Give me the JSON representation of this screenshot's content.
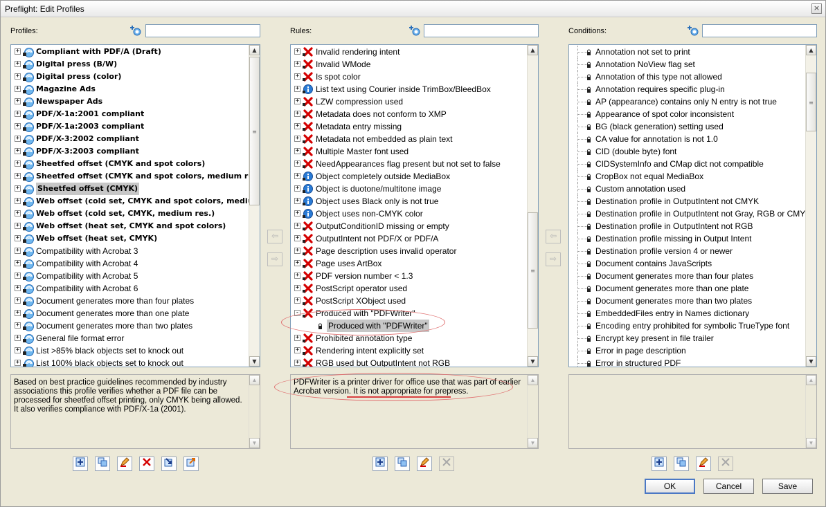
{
  "window": {
    "title": "Preflight: Edit Profiles",
    "close_glyph": "×"
  },
  "profiles": {
    "label": "Profiles:",
    "search_placeholder": "",
    "items": [
      {
        "label": "Compliant with PDF/A (Draft)",
        "bold": true
      },
      {
        "label": "Digital press (B/W)",
        "bold": true
      },
      {
        "label": "Digital press (color)",
        "bold": true
      },
      {
        "label": "Magazine Ads",
        "bold": true
      },
      {
        "label": "Newspaper Ads",
        "bold": true
      },
      {
        "label": "PDF/X-1a:2001 compliant",
        "bold": true
      },
      {
        "label": "PDF/X-1a:2003 compliant",
        "bold": true
      },
      {
        "label": "PDF/X-3:2002 compliant",
        "bold": true
      },
      {
        "label": "PDF/X-3:2003 compliant",
        "bold": true
      },
      {
        "label": "Sheetfed offset (CMYK and spot colors)",
        "bold": true
      },
      {
        "label": "Sheetfed offset (CMYK and spot colors, medium res.)",
        "bold": true
      },
      {
        "label": "Sheetfed offset (CMYK)",
        "bold": true,
        "selected": true
      },
      {
        "label": "Web offset (cold set, CMYK and spot colors, medium r",
        "bold": true
      },
      {
        "label": "Web offset (cold set, CMYK, medium res.)",
        "bold": true
      },
      {
        "label": "Web offset (heat set, CMYK and spot colors)",
        "bold": true
      },
      {
        "label": "Web offset (heat set, CMYK)",
        "bold": true
      },
      {
        "label": "Compatibility with Acrobat 3"
      },
      {
        "label": "Compatibility with Acrobat 4"
      },
      {
        "label": "Compatibility with Acrobat 5"
      },
      {
        "label": "Compatibility with Acrobat 6"
      },
      {
        "label": "Document generates more than four plates"
      },
      {
        "label": "Document generates more than one plate"
      },
      {
        "label": "Document generates more than two plates"
      },
      {
        "label": "General file format error"
      },
      {
        "label": "List >85% black objects set to knock out"
      },
      {
        "label": "List 100% black objects set to knock out"
      }
    ],
    "description": "Based on best practice guidelines recommended by industry associations this profile verifies whether a PDF file can be processed for sheetfed offset printing, only CMYK being allowed. It also verifies compliance with PDF/X-1a (2001).",
    "toolbar": [
      "new-icon",
      "duplicate-icon",
      "edit-icon",
      "delete-icon",
      "import-icon",
      "export-icon"
    ]
  },
  "rules": {
    "label": "Rules:",
    "search_placeholder": "",
    "items": [
      {
        "label": "Invalid rendering intent",
        "icon": "error"
      },
      {
        "label": "Invalid WMode",
        "icon": "error"
      },
      {
        "label": "Is spot color",
        "icon": "error"
      },
      {
        "label": "List text using Courier inside TrimBox/BleedBox",
        "icon": "info"
      },
      {
        "label": "LZW compression used",
        "icon": "error"
      },
      {
        "label": "Metadata does not conform to XMP",
        "icon": "error"
      },
      {
        "label": "Metadata entry missing",
        "icon": "error"
      },
      {
        "label": "Metadata not embedded as plain text",
        "icon": "error"
      },
      {
        "label": "Multiple Master font used",
        "icon": "error"
      },
      {
        "label": "NeedAppearances flag present but not set to false",
        "icon": "error"
      },
      {
        "label": "Object completely outside MediaBox",
        "icon": "info"
      },
      {
        "label": "Object is duotone/multitone image",
        "icon": "info"
      },
      {
        "label": "Object uses Black only is not true",
        "icon": "info"
      },
      {
        "label": "Object uses non-CMYK color",
        "icon": "info"
      },
      {
        "label": "OutputConditionID missing or empty",
        "icon": "error"
      },
      {
        "label": "OutputIntent not PDF/X or PDF/A",
        "icon": "error"
      },
      {
        "label": "Page description uses invalid operator",
        "icon": "error"
      },
      {
        "label": "Page uses ArtBox",
        "icon": "error"
      },
      {
        "label": "PDF version number < 1.3",
        "icon": "error"
      },
      {
        "label": "PostScript operator used",
        "icon": "error"
      },
      {
        "label": "PostScript XObject used",
        "icon": "error"
      },
      {
        "label": "Produced with \"PDFWriter\"",
        "icon": "error",
        "expanded": true
      },
      {
        "label": "Produced with \"PDFWriter\"",
        "icon": "condition",
        "child": true,
        "selected": true
      },
      {
        "label": "Prohibited annotation type",
        "icon": "error"
      },
      {
        "label": "Rendering intent explicitly set",
        "icon": "error"
      },
      {
        "label": "RGB used but OutputIntent not RGB",
        "icon": "error"
      }
    ],
    "description": "PDFWriter is a printer driver for office use that was part of earlier Acrobat version. It is not appropriate for prepress.",
    "toolbar": [
      "new-icon",
      "duplicate-icon",
      "edit-icon",
      "delete-icon"
    ]
  },
  "conditions": {
    "label": "Conditions:",
    "search_placeholder": "",
    "items": [
      "Annotation not set to print",
      "Annotation NoView flag set",
      "Annotation of this type not allowed",
      "Annotation requires specific plug-in",
      "AP (appearance) contains only N entry is not true",
      "Appearance of spot color inconsistent",
      "BG (black generation) setting used",
      "CA value for annotation is not 1.0",
      "CID (double byte) font",
      "CIDSystemInfo and CMap dict not compatible",
      "CropBox not equal MediaBox",
      "Custom annotation used",
      "Destination profile in OutputIntent not CMYK",
      "Destination profile in OutputIntent not Gray, RGB or CMYK",
      "Destination profile in OutputIntent not RGB",
      "Destination profile missing in Output Intent",
      "Destination profile version 4 or newer",
      "Document contains JavaScripts",
      "Document generates more than four plates",
      "Document generates more than one plate",
      "Document generates more than two plates",
      "EmbeddedFiles entry in Names dictionary",
      "Encoding entry prohibited for symbolic TrueType font",
      "Encrypt key present in file trailer",
      "Error in page description",
      "Error in structured PDF"
    ],
    "description": "",
    "toolbar": [
      "new-icon",
      "duplicate-icon",
      "edit-icon",
      "delete-icon"
    ]
  },
  "middle_buttons": {
    "add_glyph": "⇦",
    "remove_glyph": "⇨"
  },
  "buttons": {
    "ok": "OK",
    "cancel": "Cancel",
    "save": "Save"
  },
  "colors": {
    "error_red": "#d40000",
    "info_blue": "#2a7bd5",
    "annotation_red": "#e07070"
  }
}
